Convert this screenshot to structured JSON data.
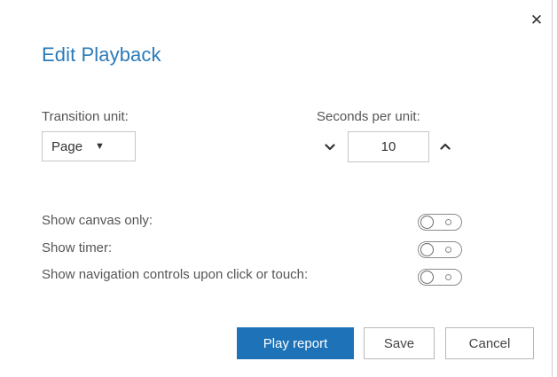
{
  "dialog": {
    "title": "Edit Playback",
    "close_icon": "close-icon",
    "close_glyph": "✕"
  },
  "transition": {
    "label": "Transition unit:",
    "selected": "Page",
    "caret": "▼"
  },
  "seconds": {
    "label": "Seconds per unit:",
    "value": "10",
    "decrement_icon": "chevron-down-icon",
    "increment_icon": "chevron-up-icon"
  },
  "options": [
    {
      "label": "Show canvas only:",
      "on": false
    },
    {
      "label": "Show timer:",
      "on": false
    },
    {
      "label": "Show navigation controls upon click or touch:",
      "on": false
    }
  ],
  "buttons": {
    "play": "Play report",
    "save": "Save",
    "cancel": "Cancel"
  },
  "colors": {
    "title": "#2b7ab8",
    "primary": "#1d72b8"
  }
}
